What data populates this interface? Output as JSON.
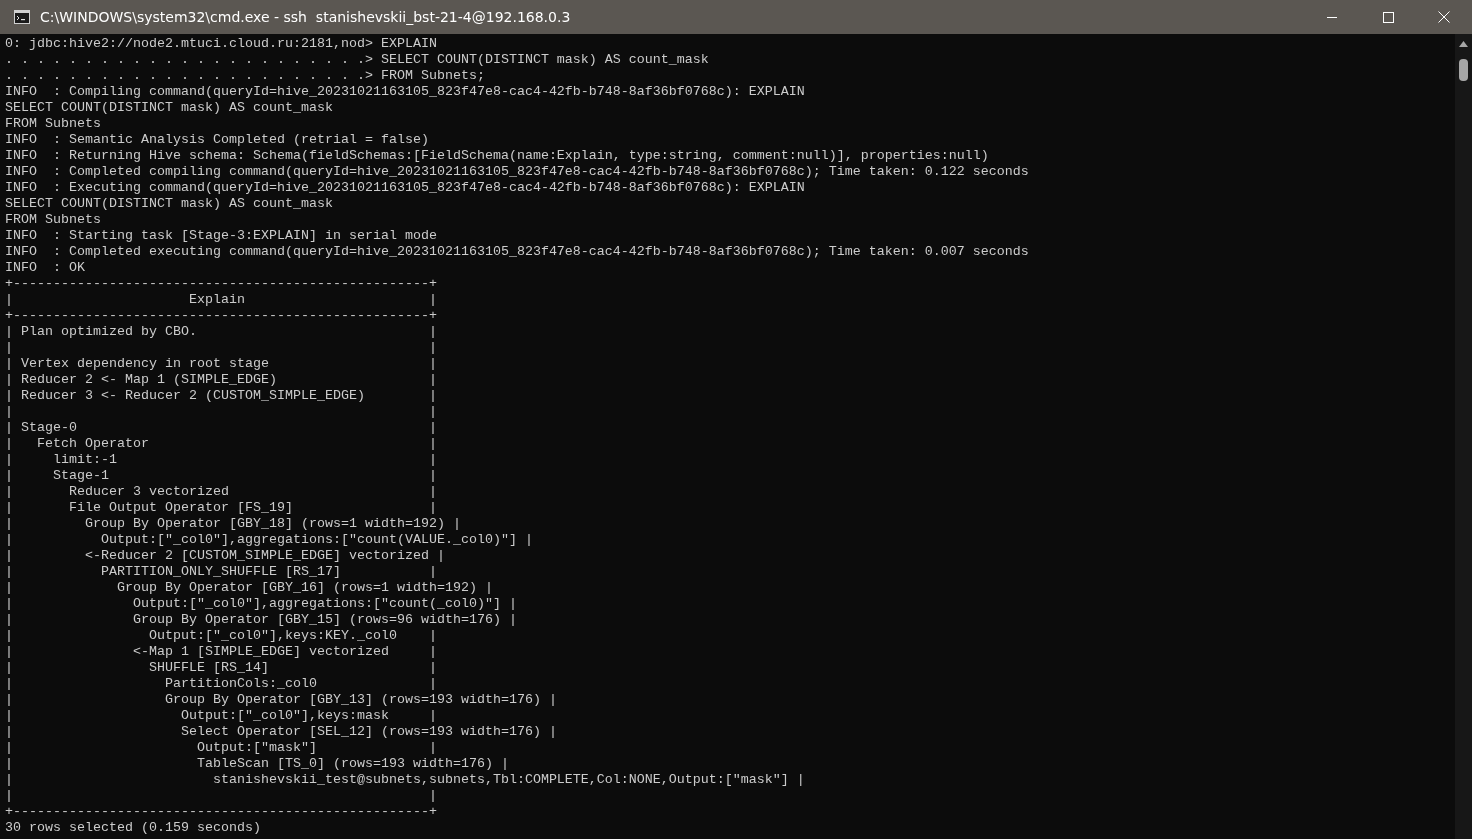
{
  "window": {
    "title": "C:\\WINDOWS\\system32\\cmd.exe - ssh  stanishevskii_bst-21-4@192.168.0.3"
  },
  "lines": [
    "0: jdbc:hive2://node2.mtuci.cloud.ru:2181,nod> EXPLAIN",
    ". . . . . . . . . . . . . . . . . . . . . . .> SELECT COUNT(DISTINCT mask) AS count_mask",
    ". . . . . . . . . . . . . . . . . . . . . . .> FROM Subnets;",
    "INFO  : Compiling command(queryId=hive_20231021163105_823f47e8-cac4-42fb-b748-8af36bf0768c): EXPLAIN",
    "SELECT COUNT(DISTINCT mask) AS count_mask",
    "FROM Subnets",
    "INFO  : Semantic Analysis Completed (retrial = false)",
    "INFO  : Returning Hive schema: Schema(fieldSchemas:[FieldSchema(name:Explain, type:string, comment:null)], properties:null)",
    "INFO  : Completed compiling command(queryId=hive_20231021163105_823f47e8-cac4-42fb-b748-8af36bf0768c); Time taken: 0.122 seconds",
    "INFO  : Executing command(queryId=hive_20231021163105_823f47e8-cac4-42fb-b748-8af36bf0768c): EXPLAIN",
    "SELECT COUNT(DISTINCT mask) AS count_mask",
    "FROM Subnets",
    "INFO  : Starting task [Stage-3:EXPLAIN] in serial mode",
    "INFO  : Completed executing command(queryId=hive_20231021163105_823f47e8-cac4-42fb-b748-8af36bf0768c); Time taken: 0.007 seconds",
    "INFO  : OK",
    "+----------------------------------------------------+",
    "|                      Explain                       |",
    "+----------------------------------------------------+",
    "| Plan optimized by CBO.                             |",
    "|                                                    |",
    "| Vertex dependency in root stage                    |",
    "| Reducer 2 <- Map 1 (SIMPLE_EDGE)                   |",
    "| Reducer 3 <- Reducer 2 (CUSTOM_SIMPLE_EDGE)        |",
    "|                                                    |",
    "| Stage-0                                            |",
    "|   Fetch Operator                                   |",
    "|     limit:-1                                       |",
    "|     Stage-1                                        |",
    "|       Reducer 3 vectorized                         |",
    "|       File Output Operator [FS_19]                 |",
    "|         Group By Operator [GBY_18] (rows=1 width=192) |",
    "|           Output:[\"_col0\"],aggregations:[\"count(VALUE._col0)\"] |",
    "|         <-Reducer 2 [CUSTOM_SIMPLE_EDGE] vectorized |",
    "|           PARTITION_ONLY_SHUFFLE [RS_17]           |",
    "|             Group By Operator [GBY_16] (rows=1 width=192) |",
    "|               Output:[\"_col0\"],aggregations:[\"count(_col0)\"] |",
    "|               Group By Operator [GBY_15] (rows=96 width=176) |",
    "|                 Output:[\"_col0\"],keys:KEY._col0    |",
    "|               <-Map 1 [SIMPLE_EDGE] vectorized     |",
    "|                 SHUFFLE [RS_14]                    |",
    "|                   PartitionCols:_col0              |",
    "|                   Group By Operator [GBY_13] (rows=193 width=176) |",
    "|                     Output:[\"_col0\"],keys:mask     |",
    "|                     Select Operator [SEL_12] (rows=193 width=176) |",
    "|                       Output:[\"mask\"]              |",
    "|                       TableScan [TS_0] (rows=193 width=176) |",
    "|                         stanishevskii_test@subnets,subnets,Tbl:COMPLETE,Col:NONE,Output:[\"mask\"] |",
    "|                                                    |",
    "+----------------------------------------------------+",
    "30 rows selected (0.159 seconds)"
  ]
}
